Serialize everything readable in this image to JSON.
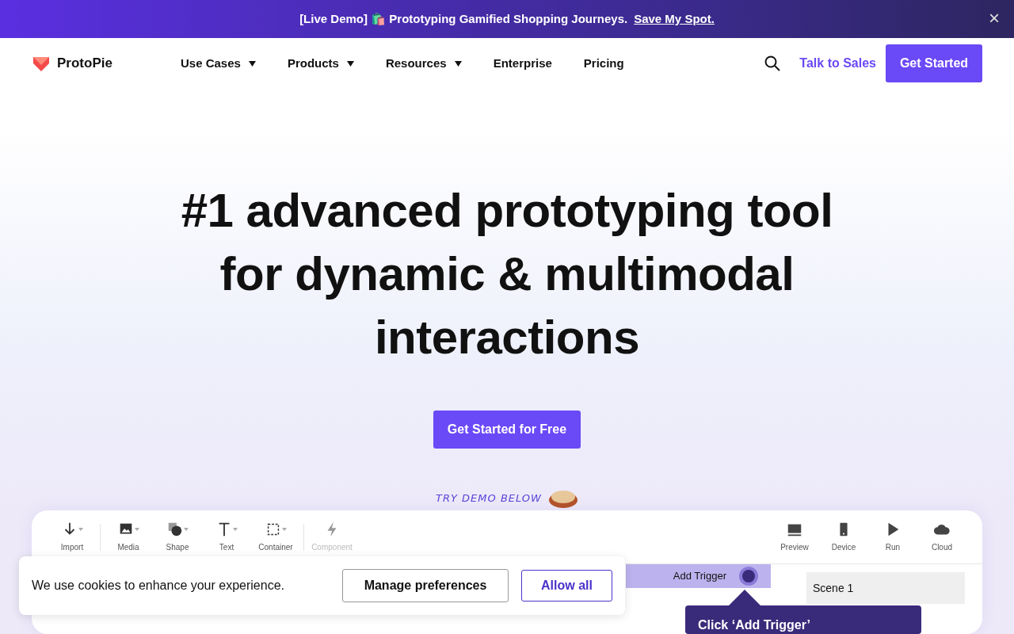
{
  "announcement": {
    "text": "[Live Demo] 🛍️ Prototyping Gamified Shopping Journeys.",
    "link": "Save My Spot.",
    "close": "×"
  },
  "navbar": {
    "brand": "ProtoPie",
    "items": [
      {
        "label": "Use Cases",
        "has_menu": true
      },
      {
        "label": "Products",
        "has_menu": true
      },
      {
        "label": "Resources",
        "has_menu": true
      },
      {
        "label": "Enterprise",
        "has_menu": false
      },
      {
        "label": "Pricing",
        "has_menu": false
      }
    ],
    "sales_link": "Talk to Sales",
    "cta": "Get Started"
  },
  "hero": {
    "title": "#1 advanced prototyping tool\nfor dynamic & multimodal\ninteractions",
    "cta": "Get Started for Free",
    "demo_hint": "TRY DEMO BELOW"
  },
  "demo": {
    "tools": [
      {
        "kind": "import",
        "label": "Import",
        "disabled": false
      },
      {
        "kind": "media",
        "label": "Media",
        "disabled": false
      },
      {
        "kind": "shape",
        "label": "Shape",
        "disabled": false
      },
      {
        "kind": "text",
        "label": "Text",
        "disabled": false
      },
      {
        "kind": "container",
        "label": "Container",
        "disabled": false
      },
      {
        "kind": "component",
        "label": "Component",
        "disabled": true
      }
    ],
    "actions": [
      {
        "kind": "preview",
        "label": "Preview"
      },
      {
        "kind": "device",
        "label": "Device"
      },
      {
        "kind": "run",
        "label": "Run"
      },
      {
        "kind": "cloud",
        "label": "Cloud"
      }
    ],
    "trigger": "Add Trigger",
    "scene": "Scene 1",
    "tooltip": "Click ‘Add Trigger’"
  },
  "cookies": {
    "text": "We use cookies to enhance your experience.",
    "manage": "Manage preferences",
    "allow": "Allow all"
  }
}
